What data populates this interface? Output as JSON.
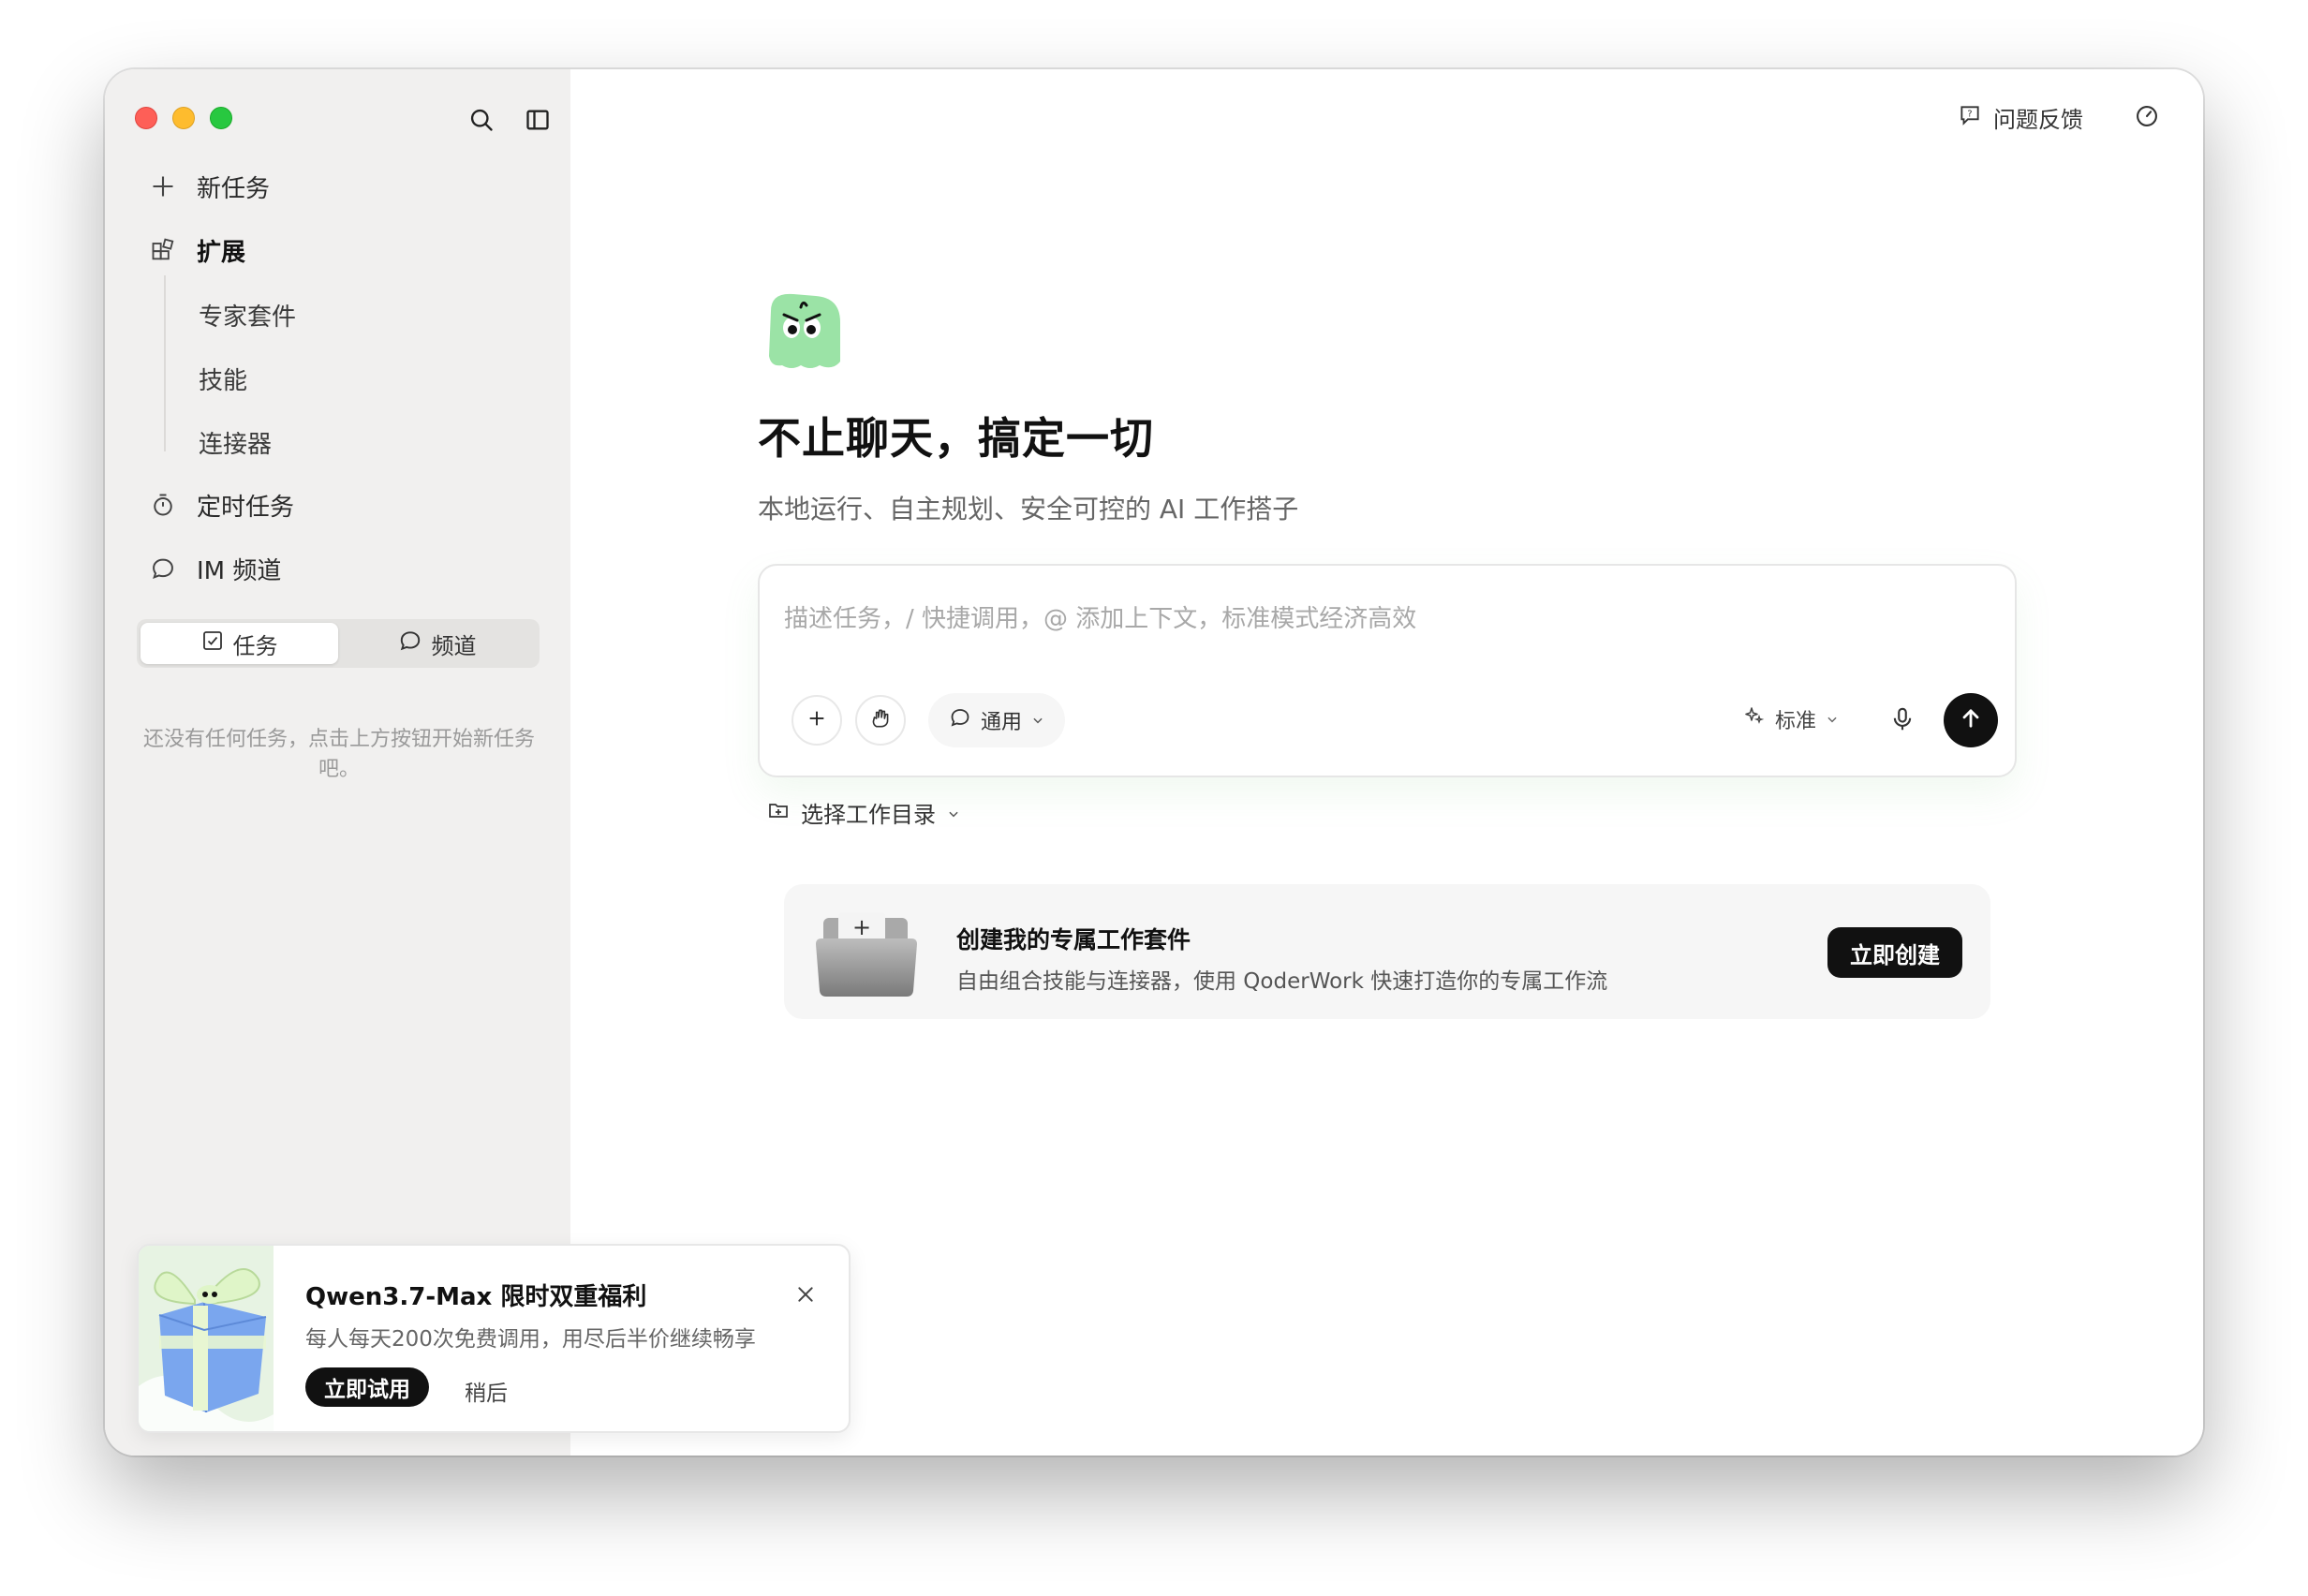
{
  "sidebar": {
    "nav": {
      "new_task": "新任务",
      "extensions": "扩展",
      "sub_items": [
        "专家套件",
        "技能",
        "连接器"
      ],
      "scheduled": "定时任务",
      "im_channel": "IM 频道"
    },
    "tabs": {
      "tasks": "任务",
      "channels": "频道"
    },
    "empty_hint": "还没有任何任务，点击上方按钮开始新任务吧。"
  },
  "topbar": {
    "feedback": "问题反馈"
  },
  "hero": {
    "title": "不止聊天，搞定一切",
    "subtitle": "本地运行、自主规划、安全可控的 AI 工作搭子"
  },
  "composer": {
    "placeholder": "描述任务，/ 快捷调用，@ 添加上下文，标准模式经济高效",
    "agent_label": "通用",
    "mode_label": "标准"
  },
  "workdir": {
    "label": "选择工作目录"
  },
  "suite_card": {
    "title": "创建我的专属工作套件",
    "description": "自由组合技能与连接器，使用 QoderWork 快速打造你的专属工作流",
    "button": "立即创建"
  },
  "promo": {
    "title": "Qwen3.7-Max 限时双重福利",
    "description": "每人每天200次免费调用，用尽后半价继续畅享",
    "try_button": "立即试用",
    "later_button": "稍后"
  },
  "colors": {
    "accent_green": "#9be3a6",
    "primary_dark": "#111111",
    "sidebar_bg": "#f1f0ef"
  }
}
